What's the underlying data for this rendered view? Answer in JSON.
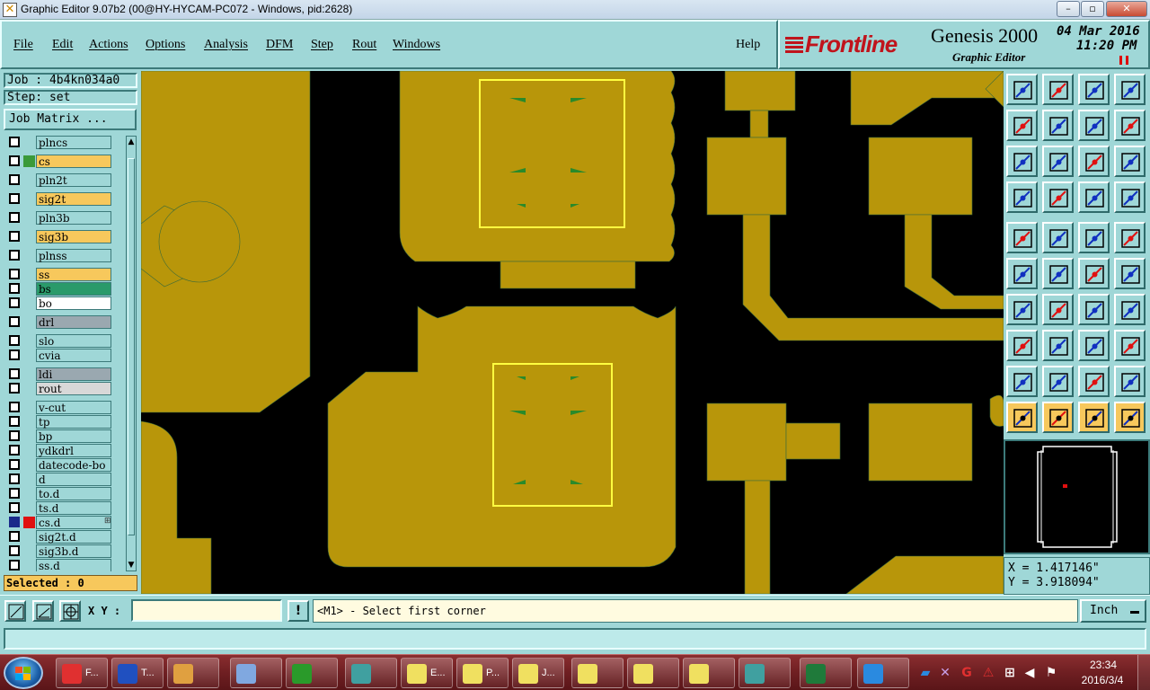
{
  "window": {
    "title": "Graphic Editor 9.07b2 (00@HY-HYCAM-PC072 - Windows, pid:2628)",
    "minimize": "–",
    "maximize": "▫",
    "close": "✕"
  },
  "menu": {
    "items": [
      "File",
      "Edit",
      "Actions",
      "Options",
      "Analysis",
      "DFM",
      "Step",
      "Rout",
      "Windows"
    ],
    "help": "Help"
  },
  "brand": {
    "logo": "Frontline",
    "product": "Genesis 2000",
    "subtitle": "Graphic Editor",
    "date": "04 Mar 2016",
    "time": "11:20 PM"
  },
  "left_panel": {
    "job": "Job : 4b4kn034a0",
    "step": "Step: set",
    "job_matrix": "Job Matrix ...",
    "layers": [
      {
        "name": "plncs",
        "bg": "#9fd7d7",
        "indicator": ""
      },
      {
        "name": "cs",
        "bg": "#f7c85c",
        "indicator": "#3a9a3a"
      },
      {
        "name": "pln2t",
        "bg": "#9fd7d7",
        "indicator": ""
      },
      {
        "name": "sig2t",
        "bg": "#f7c85c",
        "indicator": ""
      },
      {
        "name": "pln3b",
        "bg": "#9fd7d7",
        "indicator": ""
      },
      {
        "name": "sig3b",
        "bg": "#f7c85c",
        "indicator": ""
      },
      {
        "name": "plnss",
        "bg": "#9fd7d7",
        "indicator": ""
      },
      {
        "name": "ss",
        "bg": "#f7c85c",
        "indicator": ""
      },
      {
        "name": "bs",
        "bg": "#2a9a6a",
        "indicator": ""
      },
      {
        "name": "bo",
        "bg": "#ffffff",
        "indicator": ""
      },
      {
        "name": "drl",
        "bg": "#9aa8b0",
        "indicator": ""
      },
      {
        "name": "slo",
        "bg": "#9fd7d7",
        "indicator": ""
      },
      {
        "name": "cvia",
        "bg": "#9fd7d7",
        "indicator": ""
      },
      {
        "name": "ldi",
        "bg": "#9aa8b0",
        "indicator": ""
      },
      {
        "name": "rout",
        "bg": "#d8d8d8",
        "indicator": ""
      },
      {
        "name": "v-cut",
        "bg": "#9fd7d7",
        "indicator": ""
      },
      {
        "name": "tp",
        "bg": "#9fd7d7",
        "indicator": ""
      },
      {
        "name": "bp",
        "bg": "#9fd7d7",
        "indicator": ""
      },
      {
        "name": "ydkdrl",
        "bg": "#9fd7d7",
        "indicator": ""
      },
      {
        "name": "datecode-bo",
        "bg": "#9fd7d7",
        "indicator": ""
      },
      {
        "name": "d",
        "bg": "#9fd7d7",
        "indicator": ""
      },
      {
        "name": "to.d",
        "bg": "#9fd7d7",
        "indicator": ""
      },
      {
        "name": "ts.d",
        "bg": "#9fd7d7",
        "indicator": ""
      },
      {
        "name": "cs.d",
        "bg": "#9fd7d7",
        "indicator": "#e01010",
        "work": true
      },
      {
        "name": "sig2t.d",
        "bg": "#9fd7d7",
        "indicator": ""
      },
      {
        "name": "sig3b.d",
        "bg": "#9fd7d7",
        "indicator": ""
      },
      {
        "name": "ss.d",
        "bg": "#9fd7d7",
        "indicator": ""
      }
    ],
    "selected": "Selected : 0"
  },
  "coords": {
    "x": "X = 1.417146\"",
    "y": "Y = 3.918094\""
  },
  "input": {
    "xy_label": "X Y :",
    "xy_value": "",
    "exclaim": "!",
    "message": "<M1> - Select first corner",
    "units": "Inch"
  },
  "colors": {
    "copper": "#b8960a",
    "canvas_bg": "#000000",
    "selection": "#ffff40",
    "panel": "#9fd7d7",
    "layer_on": "#f7c85c"
  },
  "taskbar": {
    "tasks": [
      {
        "icon": "genesis-icon",
        "label": "F..."
      },
      {
        "icon": "save-disk-icon",
        "label": "T..."
      },
      {
        "icon": "shell-icon",
        "label": ""
      },
      {
        "icon": "notepad-icon",
        "label": ""
      },
      {
        "icon": "green-p-icon",
        "label": ""
      },
      {
        "icon": "eye-icon",
        "label": ""
      },
      {
        "icon": "editor-icon",
        "label": "E..."
      },
      {
        "icon": "editor-icon",
        "label": "P..."
      },
      {
        "icon": "editor-icon",
        "label": "J..."
      },
      {
        "icon": "editor-icon",
        "label": ""
      },
      {
        "icon": "editor-icon",
        "label": ""
      },
      {
        "icon": "editor-icon",
        "label": ""
      },
      {
        "icon": "eye-icon",
        "label": ""
      },
      {
        "icon": "excel-icon",
        "label": ""
      },
      {
        "icon": "frontline-icon",
        "label": ""
      }
    ],
    "clock_time": "23:34",
    "clock_date": "2016/3/4"
  }
}
